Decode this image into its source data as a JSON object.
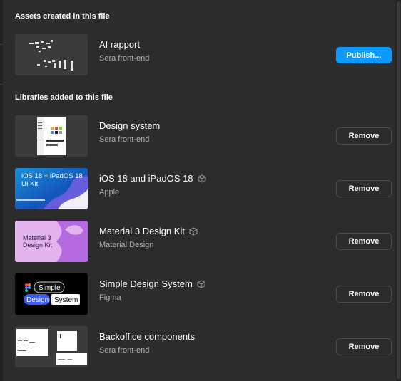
{
  "assets": {
    "title": "Assets created in this file",
    "item": {
      "name": "AI rapport",
      "source": "Sera front-end",
      "button": "Publish..."
    }
  },
  "libraries": {
    "title": "Libraries added to this file",
    "items": [
      {
        "name": "Design system",
        "source": "Sera front-end",
        "button": "Remove",
        "community": false
      },
      {
        "name": "iOS 18 and iPadOS 18",
        "source": "Apple",
        "button": "Remove",
        "community": true,
        "thumb_text": [
          "iOS 18 + iPadOS 18",
          "UI Kit"
        ]
      },
      {
        "name": "Material 3 Design Kit",
        "source": "Material Design",
        "button": "Remove",
        "community": true,
        "thumb_text": [
          "Material 3",
          "Design Kit"
        ]
      },
      {
        "name": "Simple Design System",
        "source": "Figma",
        "button": "Remove",
        "community": true,
        "thumb_text": [
          "Simple",
          "Design",
          "System"
        ]
      },
      {
        "name": "Backoffice components",
        "source": "Sera front-end",
        "button": "Remove",
        "community": false
      }
    ]
  },
  "colors": {
    "background": "#2c2c2c",
    "primary": "#0d99ff",
    "subtext": "#b3b3b3",
    "border": "#4c4c4c"
  },
  "icons": {
    "community": "package-icon"
  }
}
